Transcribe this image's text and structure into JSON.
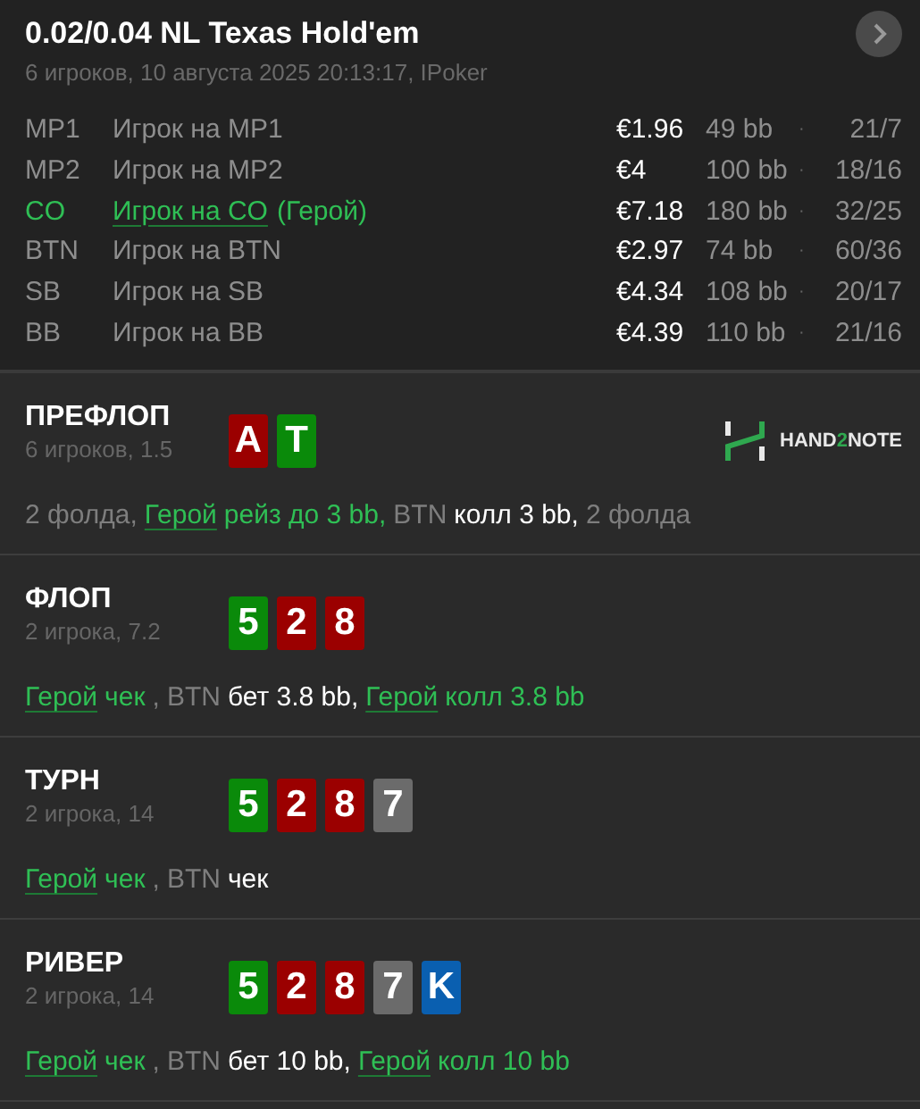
{
  "header": {
    "title": "0.02/0.04 NL Texas Hold'em",
    "subtitle": "6 игроков, 10 августа 2025 20:13:17, IPoker"
  },
  "players": [
    {
      "position": "MP1",
      "name": "Игрок на MP1",
      "hero": false,
      "stack": "€1.96",
      "bb": "49 bb",
      "sep": "·",
      "stats": "21/7"
    },
    {
      "position": "MP2",
      "name": "Игрок на MP2",
      "hero": false,
      "stack": "€4",
      "bb": "100 bb",
      "sep": "·",
      "stats": "18/16"
    },
    {
      "position": "CO",
      "name": "Игрок на CO",
      "hero": true,
      "hero_tag": "(Герой)",
      "stack": "€7.18",
      "bb": "180 bb",
      "sep": "·",
      "stats": "32/25"
    },
    {
      "position": "BTN",
      "name": "Игрок на BTN",
      "hero": false,
      "stack": "€2.97",
      "bb": "74 bb",
      "sep": "·",
      "stats": "60/36"
    },
    {
      "position": "SB",
      "name": "Игрок на SB",
      "hero": false,
      "stack": "€4.34",
      "bb": "108 bb",
      "sep": "·",
      "stats": "20/17"
    },
    {
      "position": "BB",
      "name": "Игрок на BB",
      "hero": false,
      "stack": "€4.39",
      "bb": "110 bb",
      "sep": "·",
      "stats": "21/16"
    }
  ],
  "logo": {
    "before": "HAND",
    "accent": "2",
    "after": "NOTE"
  },
  "streets": [
    {
      "title": "ПРЕФЛОП",
      "info": "6 игроков, 1.5",
      "logo": true,
      "cards": [
        {
          "rank": "A",
          "color": "#9b0000"
        },
        {
          "rank": "T",
          "color": "#0a8a0a"
        }
      ],
      "actions": [
        {
          "kind": "plain",
          "text": "2 фолда,"
        },
        {
          "kind": "hero",
          "name": "Герой",
          "action": "рейз до 3 bb,"
        },
        {
          "kind": "player",
          "name": "BTN",
          "action": "колл 3 bb,"
        },
        {
          "kind": "plain",
          "text": "2 фолда"
        }
      ]
    },
    {
      "title": "ФЛОП",
      "info": "2 игрока, 7.2",
      "logo": false,
      "cards": [
        {
          "rank": "5",
          "color": "#0a8a0a"
        },
        {
          "rank": "2",
          "color": "#9b0000"
        },
        {
          "rank": "8",
          "color": "#9b0000"
        }
      ],
      "actions": [
        {
          "kind": "hero",
          "name": "Герой",
          "action": "чек"
        },
        {
          "kind": "plain",
          "text": ","
        },
        {
          "kind": "player",
          "name": "BTN",
          "action": "бет 3.8 bb,"
        },
        {
          "kind": "hero",
          "name": "Герой",
          "action": "колл 3.8 bb"
        }
      ]
    },
    {
      "title": "ТУРН",
      "info": "2 игрока, 14",
      "logo": false,
      "cards": [
        {
          "rank": "5",
          "color": "#0a8a0a"
        },
        {
          "rank": "2",
          "color": "#9b0000"
        },
        {
          "rank": "8",
          "color": "#9b0000"
        },
        {
          "rank": "7",
          "color": "#6b6b6b"
        }
      ],
      "actions": [
        {
          "kind": "hero",
          "name": "Герой",
          "action": "чек"
        },
        {
          "kind": "plain",
          "text": ","
        },
        {
          "kind": "player",
          "name": "BTN",
          "action": "чек"
        }
      ]
    },
    {
      "title": "РИВЕР",
      "info": "2 игрока, 14",
      "logo": false,
      "cards": [
        {
          "rank": "5",
          "color": "#0a8a0a"
        },
        {
          "rank": "2",
          "color": "#9b0000"
        },
        {
          "rank": "8",
          "color": "#9b0000"
        },
        {
          "rank": "7",
          "color": "#6b6b6b"
        },
        {
          "rank": "K",
          "color": "#0a5fb0"
        }
      ],
      "actions": [
        {
          "kind": "hero",
          "name": "Герой",
          "action": "чек"
        },
        {
          "kind": "plain",
          "text": ","
        },
        {
          "kind": "player",
          "name": "BTN",
          "action": "бет 10 bb,"
        },
        {
          "kind": "hero",
          "name": "Герой",
          "action": "колл 10 bb"
        }
      ]
    }
  ]
}
